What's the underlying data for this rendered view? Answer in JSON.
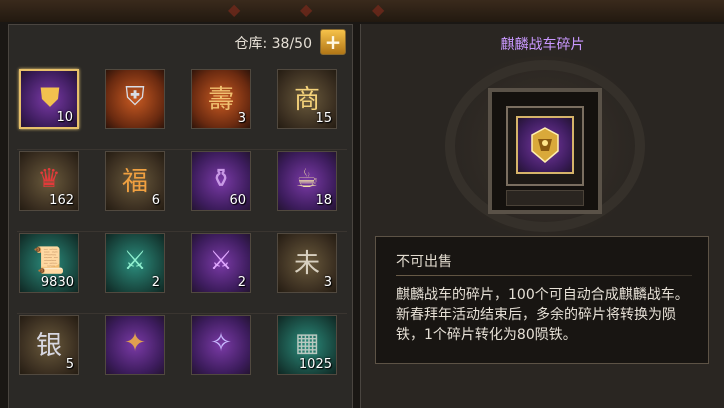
{
  "inventory": {
    "capacity_label": "仓库: 38/50",
    "add_button_label": "+",
    "slots": [
      {
        "icon": "qilin-chariot-fragment-icon",
        "quantity": "10",
        "rarity": "purple",
        "selected": true
      },
      {
        "icon": "armor-icon",
        "quantity": "",
        "rarity": "orange"
      },
      {
        "icon": "red-scroll-token-icon",
        "quantity": "3",
        "rarity": "orange"
      },
      {
        "icon": "shang-medal-icon",
        "quantity": "15",
        "rarity": "gold"
      },
      {
        "icon": "red-hat-icon",
        "quantity": "162",
        "rarity": "gold"
      },
      {
        "icon": "lucky-bag-icon",
        "quantity": "6",
        "rarity": "gold"
      },
      {
        "icon": "vase-icon",
        "quantity": "60",
        "rarity": "purple"
      },
      {
        "icon": "teapot-icon",
        "quantity": "18",
        "rarity": "purple"
      },
      {
        "icon": "scroll-icon",
        "quantity": "9830",
        "rarity": "green"
      },
      {
        "icon": "green-blade-icon",
        "quantity": "2",
        "rarity": "green"
      },
      {
        "icon": "purple-blade-icon",
        "quantity": "2",
        "rarity": "purple"
      },
      {
        "icon": "stone-tablet-icon",
        "quantity": "3",
        "rarity": "gold"
      },
      {
        "icon": "silver-token-icon",
        "quantity": "5",
        "rarity": "gold"
      },
      {
        "icon": "scale-wing-icon",
        "quantity": "",
        "rarity": "purple"
      },
      {
        "icon": "magic-scroll-icon",
        "quantity": "",
        "rarity": "purple"
      },
      {
        "icon": "iron-ingot-icon",
        "quantity": "1025",
        "rarity": "green"
      }
    ]
  },
  "detail": {
    "title": "麒麟战车碎片",
    "sale_status": "不可出售",
    "description": "麒麟战车的碎片，100个可自动合成麒麟战车。新春拜年活动结束后，多余的碎片将转换为陨铁，1个碎片转化为80陨铁。",
    "title_color": "#c998ff"
  }
}
